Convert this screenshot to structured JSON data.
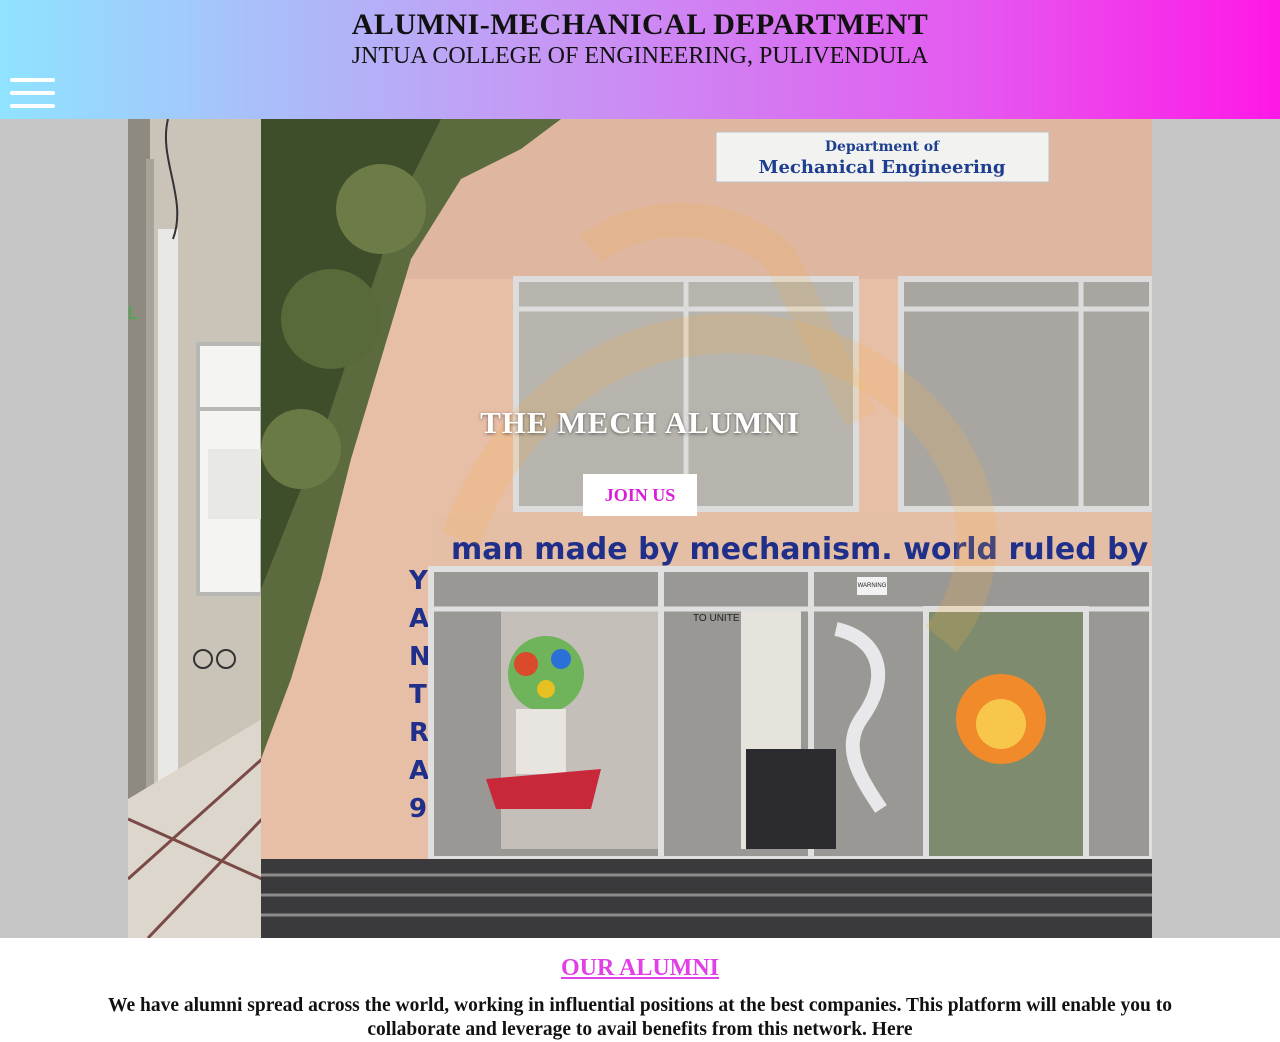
{
  "header": {
    "title": "ALUMNI-MECHANICAL DEPARTMENT",
    "subtitle": "JNTUA COLLEGE OF ENGINEERING, PULIVENDULA",
    "menu_icon": "hamburger-menu-icon"
  },
  "hero": {
    "heading": "THE MECH ALUMNI",
    "join_button": "JOIN US",
    "photo": {
      "sign_line1": "Department of",
      "sign_line2": "Mechanical Engineering",
      "banner": "man made by mechanism. world ruled by mecha",
      "side_letters": "YANTRA9",
      "door_sign": "TO UNITE",
      "warning_sign": "WARNING"
    }
  },
  "alumni": {
    "heading": "OUR ALUMNI",
    "text": "We have alumni spread across the world, working in influential positions at the best companies. This platform will enable you to collaborate and leverage to avail benefits from this network. Here"
  },
  "colors": {
    "header_gradient": [
      "#8fe3ff",
      "#c39cf5",
      "#e35cf0",
      "#ff18e6"
    ],
    "accent": "#e040e6",
    "button_text": "#d81fd8"
  }
}
